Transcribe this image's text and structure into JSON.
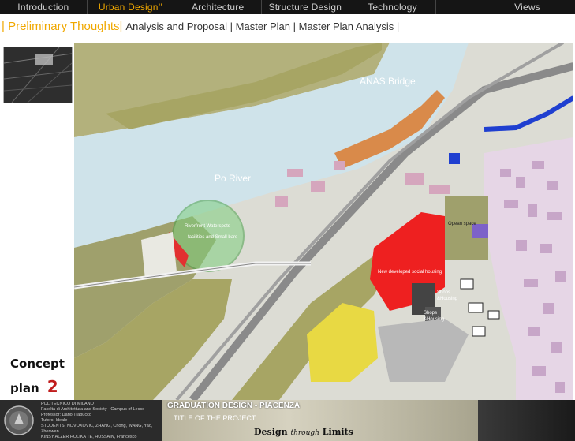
{
  "nav": {
    "items": [
      {
        "label": "Introduction"
      },
      {
        "label": "Urban Design’’",
        "active": true
      },
      {
        "label": "Architecture"
      },
      {
        "label": "Structure Design"
      },
      {
        "label": "Technology"
      },
      {
        "label": "Views"
      }
    ]
  },
  "breadcrumb": {
    "main": "| Preliminary  Thoughts|",
    "sub": "Analysis and Proposal | Master Plan | Master Plan Analysis |"
  },
  "map": {
    "labels": {
      "bridge": "ANAS Bridge",
      "river": "Po River",
      "waterspots": "Riverfront Waterspots",
      "facilities": "facilities and Small bars",
      "open_space": "Opean space",
      "housing": "New developed social housing",
      "shops1": "Shops",
      "housing1": "&Housing",
      "shops2": "Shops",
      "housing2": "&Housing"
    }
  },
  "concept": {
    "word1": "Concept",
    "word2": "plan",
    "number": "2"
  },
  "footer": {
    "school_lines": [
      "POLITECNICO DI MILANO",
      "Facolta di Architettura and Society - Campus of Lecco",
      "Professor: Dario Trabucco",
      "Tutors: Ideale",
      "STUDENTS: NOVOXOVIC, ZHANG, Chong, WANG, Yao, Zhenwen",
      "KINSY ALZER HOLIKA TE, HUSSAIN, Francesco"
    ],
    "title": "GRADUATION DESIGN - PIACENZA",
    "subtitle": "TITLE OF THE PROJECT",
    "slogan_a": "Design",
    "slogan_b": "through",
    "slogan_c": "Limits"
  },
  "colors": {
    "accent": "#f0a800",
    "river": "#cfe3ea",
    "green": "#a7a564",
    "housing": "#ee2020",
    "yellow": "#e8d943",
    "pink": "#c7a6c8"
  }
}
